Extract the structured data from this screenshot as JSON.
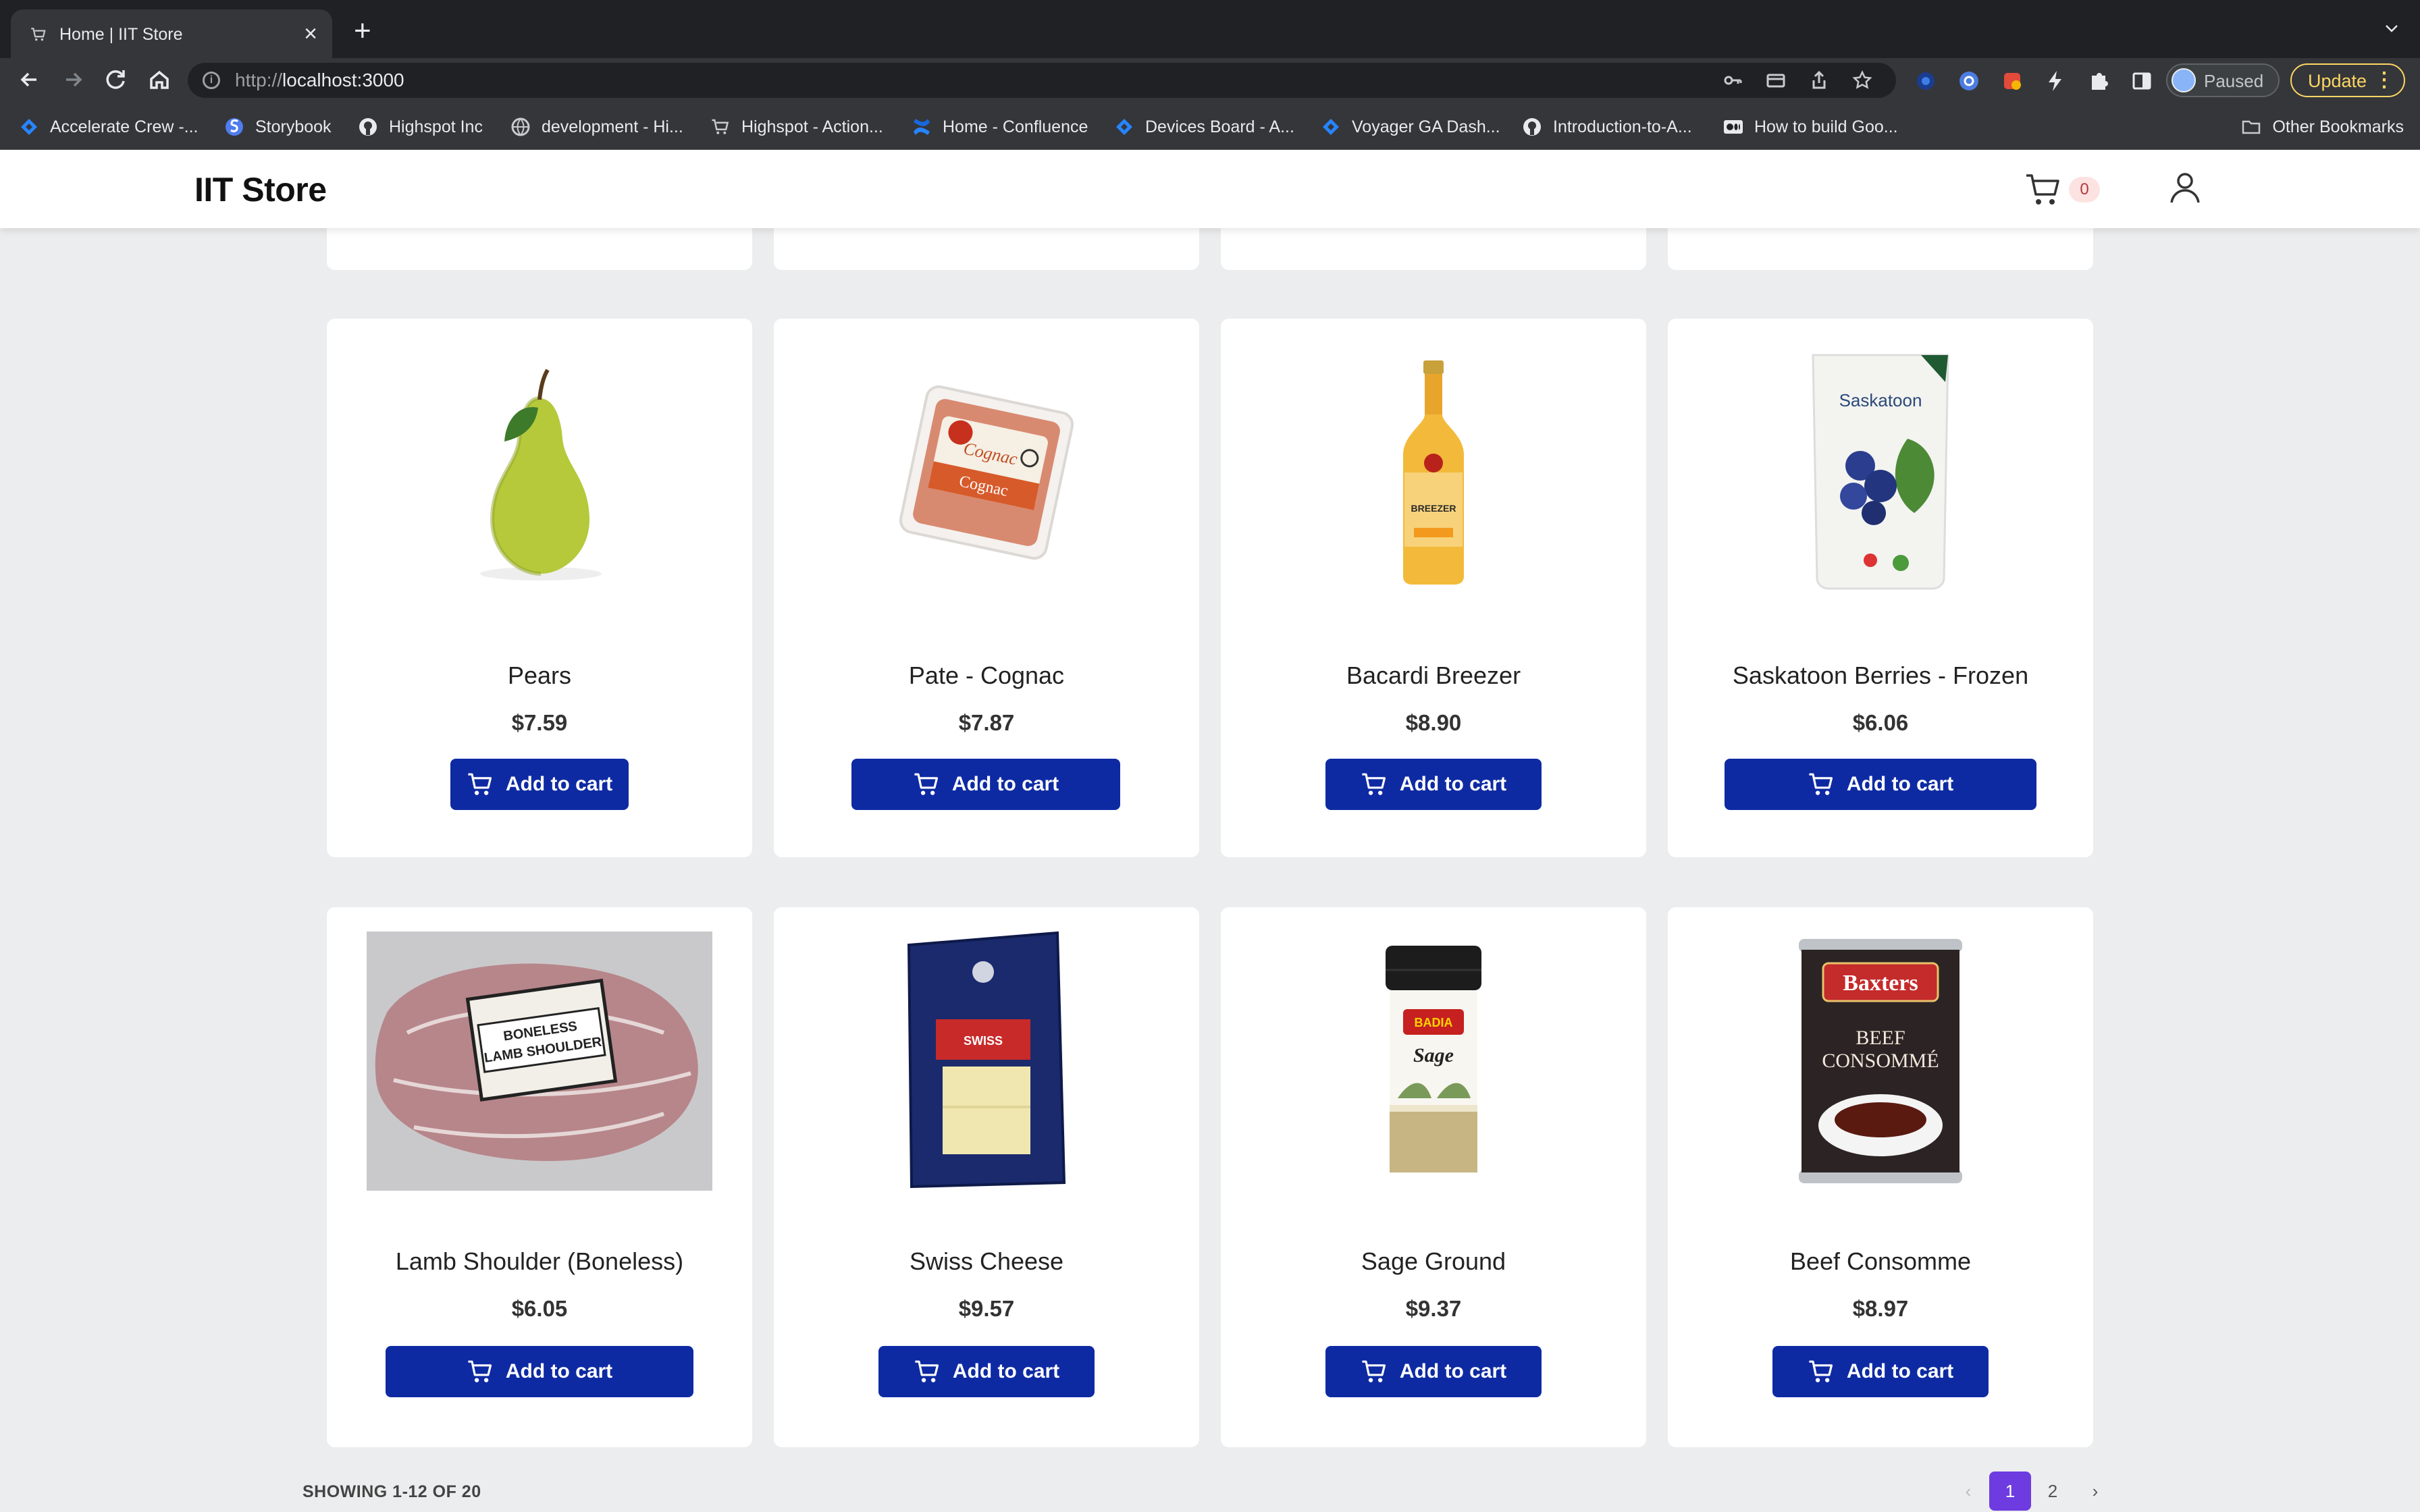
{
  "browser": {
    "tab_title": "Home | IIT Store",
    "url_scheme": "http://",
    "url_host": "localhost:3000",
    "profile_label": "Paused",
    "update_label": "Update",
    "bookmarks": [
      {
        "label": "Accelerate Crew -...",
        "icon": "jira-icon"
      },
      {
        "label": "Storybook",
        "icon": "storybook-icon"
      },
      {
        "label": "Highspot Inc",
        "icon": "github-icon"
      },
      {
        "label": "development - Hi...",
        "icon": "globe-icon"
      },
      {
        "label": "Highspot - Action...",
        "icon": "cart-icon"
      },
      {
        "label": "Home - Confluence",
        "icon": "confluence-icon"
      },
      {
        "label": "Devices Board - A...",
        "icon": "jira-icon"
      },
      {
        "label": "Voyager GA Dash...",
        "icon": "jira-icon"
      },
      {
        "label": "Introduction-to-A...",
        "icon": "github-icon"
      },
      {
        "label": "How to build Goo...",
        "icon": "medium-icon"
      }
    ],
    "other_bookmarks": "Other Bookmarks"
  },
  "site": {
    "logo": "IIT Store",
    "cart_count": "0"
  },
  "products": [
    {
      "name": "Pears",
      "price": "$7.59",
      "button": "Add to cart",
      "image": "pear"
    },
    {
      "name": "Pate - Cognac",
      "price": "$7.87",
      "button": "Add to cart",
      "image": "pate"
    },
    {
      "name": "Bacardi Breezer",
      "price": "$8.90",
      "button": "Add to cart",
      "image": "bottle"
    },
    {
      "name": "Saskatoon Berries - Frozen",
      "price": "$6.06",
      "button": "Add to cart",
      "image": "berry-bag"
    },
    {
      "name": "Lamb Shoulder (Boneless)",
      "price": "$6.05",
      "button": "Add to cart",
      "image": "lamb"
    },
    {
      "name": "Swiss Cheese",
      "price": "$9.57",
      "button": "Add to cart",
      "image": "cheese"
    },
    {
      "name": "Sage Ground",
      "price": "$9.37",
      "button": "Add to cart",
      "image": "spice-jar"
    },
    {
      "name": "Beef Consomme",
      "price": "$8.97",
      "button": "Add to cart",
      "image": "soup-can"
    }
  ],
  "image_text": {
    "pate_label": "Cognac",
    "breezer_label": "BREEZER",
    "saskatoon_label": "Saskatoon",
    "lamb_label_1": "BONELESS",
    "lamb_label_2": "LAMB SHOULDER",
    "cheese_label": "SWISS",
    "sage_brand": "BADIA",
    "sage_label": "Sage",
    "baxters_brand": "Baxters",
    "consomme_label_1": "BEEF",
    "consomme_label_2": "CONSOMMÉ"
  },
  "pagination": {
    "showing": "SHOWING 1-12 OF 20",
    "prev": "‹",
    "current": "1",
    "page2": "2",
    "next": "›"
  },
  "colors": {
    "button": "#0e2aa3",
    "pager_active": "#6d3be0",
    "background": "#ecedee"
  }
}
